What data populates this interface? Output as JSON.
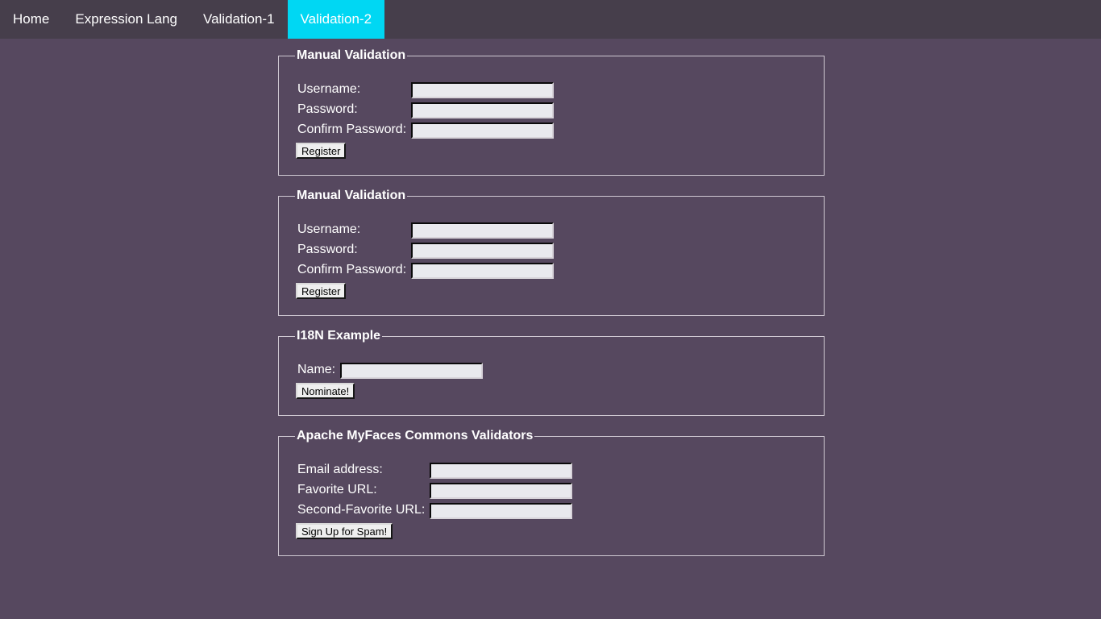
{
  "nav": {
    "items": [
      {
        "label": "Home",
        "active": false
      },
      {
        "label": "Expression Lang",
        "active": false
      },
      {
        "label": "Validation-1",
        "active": false
      },
      {
        "label": "Validation-2",
        "active": true
      }
    ],
    "active_color": "#00d7f3",
    "bar_color": "#463e4b"
  },
  "page": {
    "background_color": "#56485f"
  },
  "panels": [
    {
      "legend": "Manual Validation",
      "fields": [
        {
          "label": "Username:",
          "value": ""
        },
        {
          "label": "Password:",
          "value": ""
        },
        {
          "label": "Confirm Password:",
          "value": ""
        }
      ],
      "button": "Register"
    },
    {
      "legend": "Manual Validation",
      "fields": [
        {
          "label": "Username:",
          "value": ""
        },
        {
          "label": "Password:",
          "value": ""
        },
        {
          "label": "Confirm Password:",
          "value": ""
        }
      ],
      "button": "Register"
    },
    {
      "legend": "I18N Example",
      "fields": [
        {
          "label": "Name:",
          "value": ""
        }
      ],
      "button": "Nominate!"
    },
    {
      "legend": "Apache MyFaces Commons Validators",
      "fields": [
        {
          "label": "Email address:",
          "value": ""
        },
        {
          "label": "Favorite URL:",
          "value": ""
        },
        {
          "label": "Second-Favorite URL:",
          "value": ""
        }
      ],
      "button": "Sign Up for Spam!"
    }
  ]
}
